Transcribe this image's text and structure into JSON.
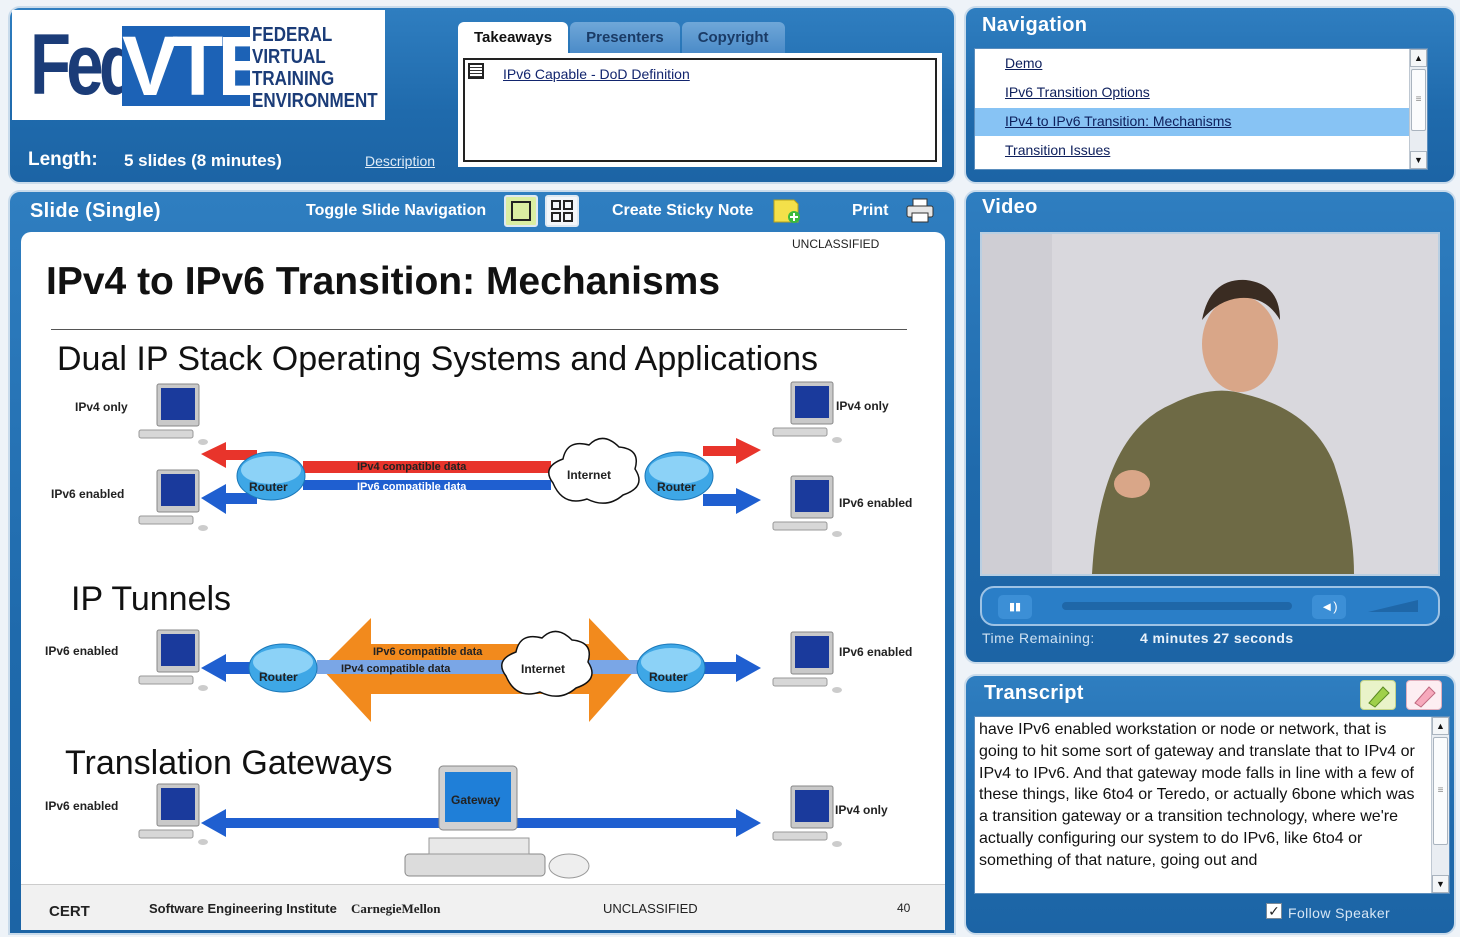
{
  "header": {
    "logo": {
      "fed": "Fed",
      "vte": "VTE",
      "subtitle": [
        "FEDERAL",
        "VIRTUAL",
        "TRAINING",
        "ENVIRONMENT"
      ]
    },
    "length_label": "Length:",
    "length_value": "5 slides (8 minutes)",
    "description_link": "Description",
    "tabs": [
      "Takeaways",
      "Presenters",
      "Copyright"
    ],
    "takeaway_link": "IPv6 Capable - DoD Definition"
  },
  "navigation": {
    "title": "Navigation",
    "items": [
      "Demo",
      "IPv6 Transition Options",
      "IPv4 to IPv6 Transition:  Mechanisms",
      "Transition Issues"
    ],
    "selected_index": 2
  },
  "slide_panel": {
    "title": "Slide (Single)",
    "toggle_nav": "Toggle Slide Navigation",
    "sticky": "Create Sticky Note",
    "print": "Print"
  },
  "slide": {
    "classification_top": "UNCLASSIFIED",
    "title": "IPv4 to IPv6 Transition:  Mechanisms",
    "sections": [
      "Dual IP Stack Operating Systems and Applications",
      "IP Tunnels",
      "Translation Gateways"
    ],
    "labels": {
      "ipv4_only": "IPv4 only",
      "ipv6_enabled": "IPv6 enabled",
      "router": "Router",
      "internet": "Internet",
      "ipv4_data": "IPv4 compatible data",
      "ipv6_data": "IPv6 compatible data",
      "gateway": "Gateway"
    },
    "footer": {
      "cert": "CERT",
      "sei": "Software Engineering Institute",
      "cmu": "CarnegieMellon",
      "classification": "UNCLASSIFIED",
      "page": "40"
    }
  },
  "video": {
    "title": "Video",
    "time_label": "Time Remaining:",
    "time_value": "4 minutes 27 seconds"
  },
  "transcript": {
    "title": "Transcript",
    "text": "have IPv6 enabled workstation or node or network, that is going to hit some sort of gateway and translate that to IPv4 or IPv4 to IPv6. And that gateway mode falls in line with a few of these things, like 6to4 or Teredo, or actually 6bone which was a transition gateway or a transition technology, where we're actually configuring our system to do IPv6, like 6to4 or something of that nature, going out and",
    "follow_speaker": "Follow Speaker"
  },
  "colors": {
    "accent": "#1f6aac",
    "selected": "#87c3f4",
    "ipv4": "#e8342b",
    "ipv6": "#1f5fd0",
    "tunnel": "#f28a1d"
  }
}
